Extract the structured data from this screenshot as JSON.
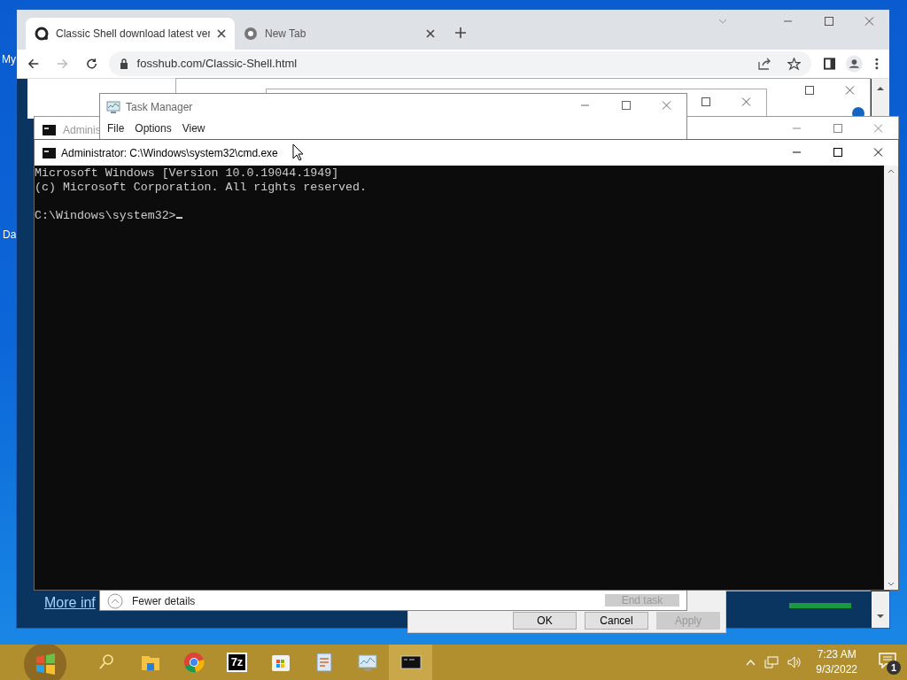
{
  "desktop": {
    "icon_labels": [
      "My",
      "Da"
    ]
  },
  "browser": {
    "tabs": [
      {
        "title": "Classic Shell download latest ver",
        "selected": true
      },
      {
        "title": "New Tab",
        "selected": false
      }
    ],
    "address": "fosshub.com/Classic-Shell.html",
    "page_link": "More inf"
  },
  "properties_dialog": {
    "buttons": [
      {
        "label": "OK",
        "disabled": false
      },
      {
        "label": "Cancel",
        "disabled": false
      },
      {
        "label": "Apply",
        "disabled": true
      }
    ]
  },
  "back_console": {
    "title": "Adminis"
  },
  "task_manager": {
    "title": "Task Manager",
    "menu": [
      "File",
      "Options",
      "View"
    ],
    "details_toggle": "Fewer details",
    "end_task": {
      "label": "End task",
      "disabled": true
    }
  },
  "console": {
    "title": "Administrator: C:\\Windows\\system32\\cmd.exe",
    "lines": [
      "Microsoft Windows [Version 10.0.19044.1949]",
      "(c) Microsoft Corporation. All rights reserved."
    ],
    "prompt": "C:\\Windows\\system32>"
  },
  "taskbar": {
    "apps": [
      {
        "kind": "search",
        "selected": false
      },
      {
        "kind": "explorer",
        "selected": false
      },
      {
        "kind": "chrome",
        "selected": false
      },
      {
        "kind": "archiver",
        "label": "7z",
        "selected": false
      },
      {
        "kind": "store",
        "selected": false
      },
      {
        "kind": "editor",
        "selected": false
      },
      {
        "kind": "monitor",
        "selected": false
      },
      {
        "kind": "console",
        "selected": true
      }
    ],
    "time": "7:23 AM",
    "date": "9/3/2022",
    "notifications": "1"
  }
}
